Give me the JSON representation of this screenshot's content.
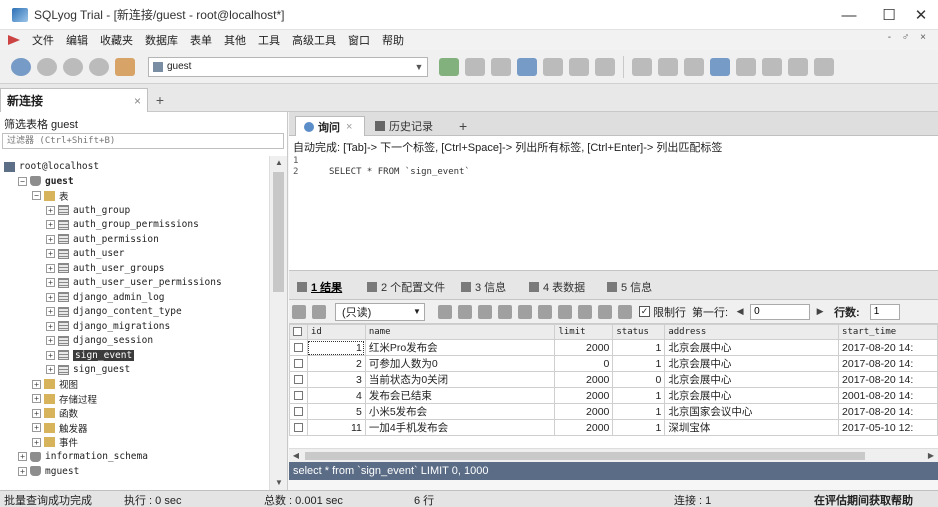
{
  "window": {
    "title": "SQLyog Trial - [新连接/guest - root@localhost*]",
    "minimize": "—",
    "maximize": "☐",
    "close": "✕"
  },
  "menu": {
    "items": [
      "文件",
      "编辑",
      "收藏夹",
      "数据库",
      "表单",
      "其他",
      "工具",
      "高级工具",
      "窗口",
      "帮助"
    ],
    "window_controls": "- ♂ ×"
  },
  "toolbar": {
    "database_select": "guest"
  },
  "connection_tab": {
    "label": "新连接",
    "close": "×",
    "add": "+"
  },
  "left_panel": {
    "filter_label": "筛选表格 guest",
    "filter_placeholder": "过滤器 (Ctrl+Shift+B)",
    "tree": [
      {
        "label": "root@localhost",
        "icon": "server-icon",
        "toggle": "",
        "level": 0
      },
      {
        "label": "guest",
        "icon": "database-icon",
        "toggle": "−",
        "level": 1,
        "bold": true
      },
      {
        "label": "表",
        "icon": "folder-icon",
        "toggle": "−",
        "level": 2
      },
      {
        "label": "auth_group",
        "icon": "table-icon",
        "toggle": "+",
        "level": 3
      },
      {
        "label": "auth_group_permissions",
        "icon": "table-icon",
        "toggle": "+",
        "level": 3
      },
      {
        "label": "auth_permission",
        "icon": "table-icon",
        "toggle": "+",
        "level": 3
      },
      {
        "label": "auth_user",
        "icon": "table-icon",
        "toggle": "+",
        "level": 3
      },
      {
        "label": "auth_user_groups",
        "icon": "table-icon",
        "toggle": "+",
        "level": 3
      },
      {
        "label": "auth_user_user_permissions",
        "icon": "table-icon",
        "toggle": "+",
        "level": 3
      },
      {
        "label": "django_admin_log",
        "icon": "table-icon",
        "toggle": "+",
        "level": 3
      },
      {
        "label": "django_content_type",
        "icon": "table-icon",
        "toggle": "+",
        "level": 3
      },
      {
        "label": "django_migrations",
        "icon": "table-icon",
        "toggle": "+",
        "level": 3
      },
      {
        "label": "django_session",
        "icon": "table-icon",
        "toggle": "+",
        "level": 3
      },
      {
        "label": "sign_event",
        "icon": "table-icon",
        "toggle": "+",
        "level": 3,
        "selected": true
      },
      {
        "label": "sign_guest",
        "icon": "table-icon",
        "toggle": "+",
        "level": 3
      },
      {
        "label": "视图",
        "icon": "folder-icon",
        "toggle": "+",
        "level": 2
      },
      {
        "label": "存储过程",
        "icon": "folder-icon",
        "toggle": "+",
        "level": 2
      },
      {
        "label": "函数",
        "icon": "folder-icon",
        "toggle": "+",
        "level": 2
      },
      {
        "label": "触发器",
        "icon": "folder-icon",
        "toggle": "+",
        "level": 2
      },
      {
        "label": "事件",
        "icon": "folder-icon",
        "toggle": "+",
        "level": 2
      },
      {
        "label": "information_schema",
        "icon": "database-icon",
        "toggle": "+",
        "level": 1
      },
      {
        "label": "mguest",
        "icon": "database-icon",
        "toggle": "+",
        "level": 1
      }
    ]
  },
  "editor": {
    "tab_query": "询问",
    "tab_query_close": "×",
    "tab_history": "历史记录",
    "tab_add": "+",
    "hint": "自动完成: [Tab]-> 下一个标签, [Ctrl+Space]-> 列出所有标签, [Ctrl+Enter]-> 列出匹配标签",
    "line_numbers": [
      "1",
      "2"
    ],
    "sql": "SELECT * FROM `sign_event`"
  },
  "results": {
    "tabs": [
      "1 结果",
      "2 个配置文件",
      "3 信息",
      "4 表数据",
      "5 信息"
    ],
    "mode": "(只读)",
    "limit_label": "限制行",
    "first_row_label": "第一行:",
    "first_row_value": "0",
    "rows_label": "行数:",
    "rows_value": "1",
    "prev": "◀",
    "next": "▶",
    "columns": [
      "id",
      "name",
      "limit",
      "status",
      "address",
      "start_time"
    ],
    "rows": [
      [
        "1",
        "红米Pro发布会",
        "2000",
        "1",
        "北京会展中心",
        "2017-08-20 14:"
      ],
      [
        "2",
        "可参加人数为0",
        "0",
        "1",
        "北京会展中心",
        "2017-08-20 14:"
      ],
      [
        "3",
        "当前状态为0关闭",
        "2000",
        "0",
        "北京会展中心",
        "2017-08-20 14:"
      ],
      [
        "4",
        "发布会已结束",
        "2000",
        "1",
        "北京会展中心",
        "2001-08-20 14:"
      ],
      [
        "5",
        "小米5发布会",
        "2000",
        "1",
        "北京国家会议中心",
        "2017-08-20 14:"
      ],
      [
        "11",
        "一加4手机发布会",
        "2000",
        "1",
        "深圳宝体",
        "2017-05-10 12:"
      ]
    ],
    "status_sql": "select * from `sign_event` LIMIT 0, 1000"
  },
  "statusbar": {
    "message": "批量查询成功完成",
    "exec": "执行 : 0 sec",
    "total": "总数 : 0.001 sec",
    "rows": "6 行",
    "connections": "连接 : 1",
    "register": "在评估期间获取帮助"
  }
}
